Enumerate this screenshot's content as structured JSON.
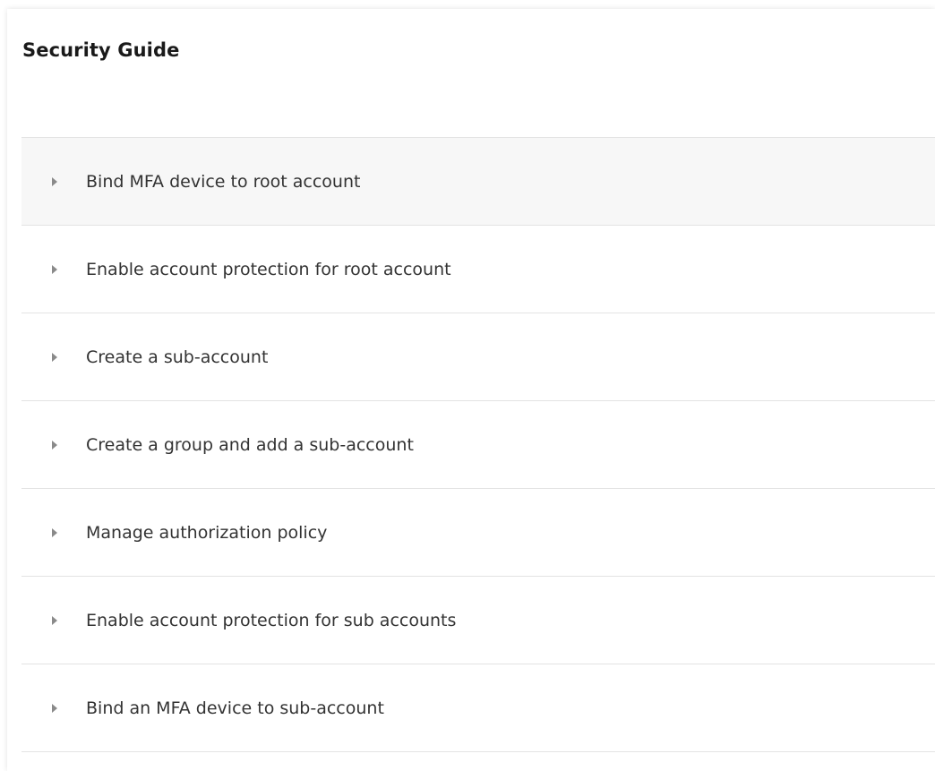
{
  "panel": {
    "title": "Security Guide"
  },
  "guide": {
    "items": [
      {
        "label": "Bind MFA device to root account",
        "icon": "caret-right-icon"
      },
      {
        "label": "Enable account protection for root account",
        "icon": "caret-right-icon"
      },
      {
        "label": "Create a sub-account",
        "icon": "caret-right-icon"
      },
      {
        "label": "Create a group and add a sub-account",
        "icon": "caret-right-icon"
      },
      {
        "label": "Manage authorization policy",
        "icon": "caret-right-icon"
      },
      {
        "label": "Enable account protection for sub accounts",
        "icon": "caret-right-icon"
      },
      {
        "label": "Bind an MFA device to sub-account",
        "icon": "caret-right-icon"
      }
    ]
  },
  "colors": {
    "hover_row": "#f7f7f7",
    "divider": "#e3e3e3",
    "caret": "#8a8a8a"
  }
}
